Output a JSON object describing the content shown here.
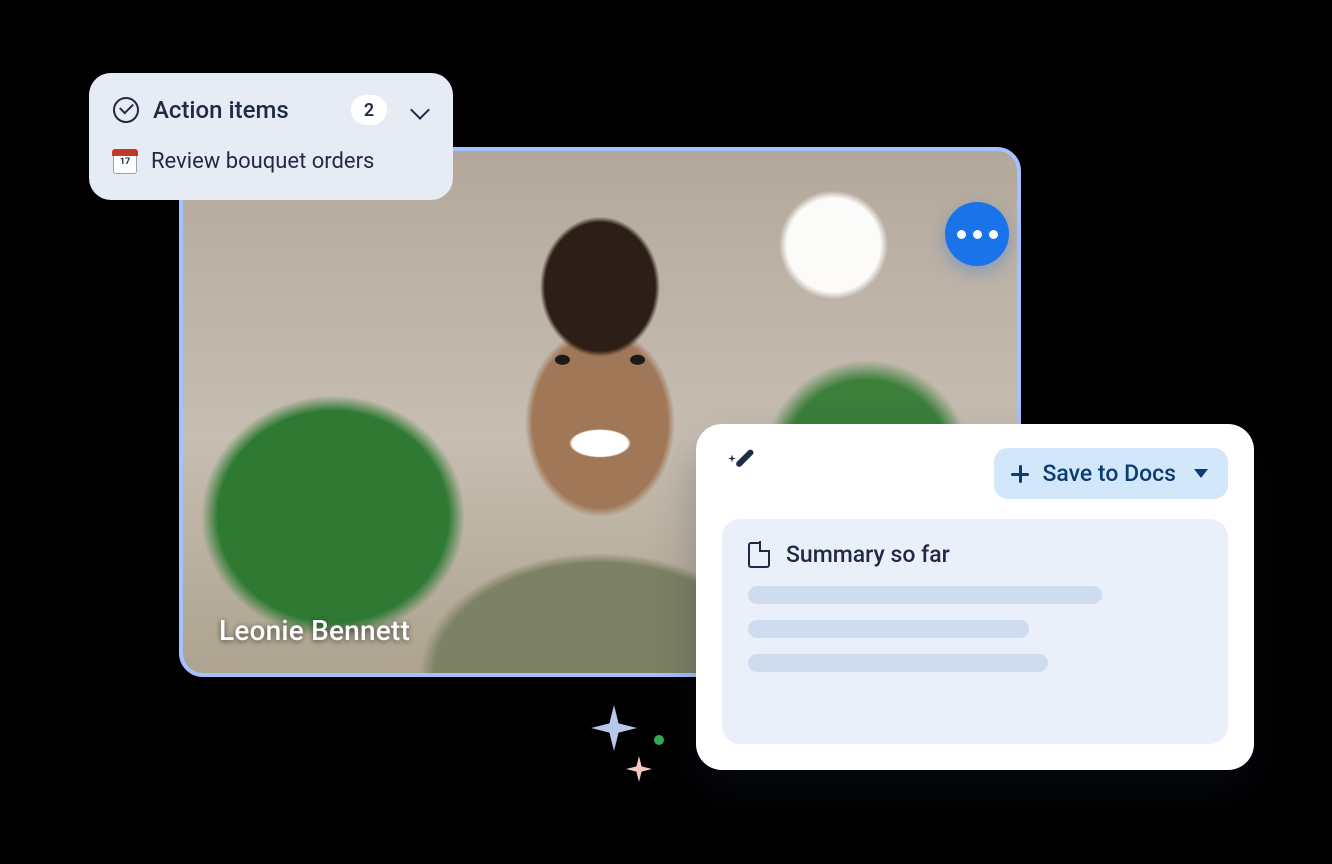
{
  "video": {
    "participant_name": "Leonie Bennett"
  },
  "action_items": {
    "title": "Action items",
    "count": "2",
    "items": [
      {
        "label": "Review bouquet orders"
      }
    ]
  },
  "summary": {
    "save_button_label": "Save to Docs",
    "title": "Summary so far"
  },
  "colors": {
    "accent_blue": "#1a73e8",
    "panel_bg": "#e7ecf4",
    "save_btn_bg": "#d3e7fb",
    "summary_body_bg": "#eaf0fa"
  }
}
